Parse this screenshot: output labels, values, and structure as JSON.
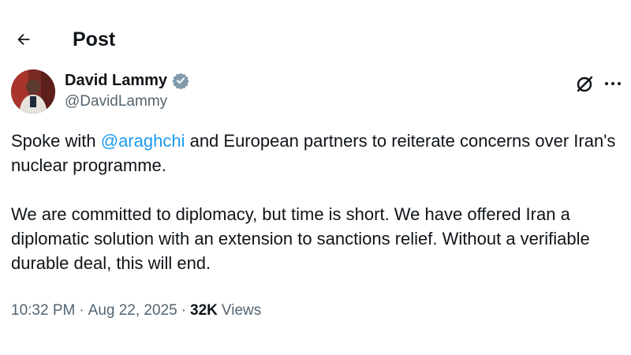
{
  "header": {
    "title": "Post"
  },
  "author": {
    "name": "David Lammy",
    "handle": "@DavidLammy"
  },
  "post": {
    "line1_pre": "Spoke with ",
    "mention": "@araghchi",
    "line1_post": " and European partners to reiterate concerns over Iran's nuclear programme.",
    "paragraph2": "We are committed to diplomacy, but time is short. We have offered Iran a diplomatic solution with an extension to sanctions relief. Without a verifiable durable deal, this will end."
  },
  "meta": {
    "time": "10:32 PM",
    "date": "Aug 22, 2025",
    "views_count": "32K",
    "views_label": "Views"
  },
  "colors": {
    "mention": "#1d9bf0",
    "secondary_text": "#536471",
    "verified": "#829aab"
  },
  "icons": [
    "back-arrow-icon",
    "verified-badge-icon",
    "grok-icon",
    "more-icon"
  ]
}
